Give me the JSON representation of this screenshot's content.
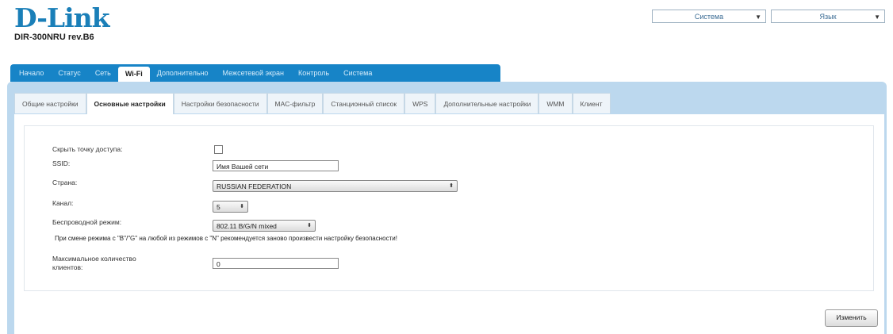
{
  "brand": {
    "logo": "D-Link",
    "model": "DIR-300NRU rev.B6",
    "color": "#1a7fb8"
  },
  "top_selects": [
    {
      "value": "Система"
    },
    {
      "value": "Язык"
    }
  ],
  "main_tabs": [
    {
      "label": "Начало",
      "active": false
    },
    {
      "label": "Статус",
      "active": false
    },
    {
      "label": "Сеть",
      "active": false
    },
    {
      "label": "Wi-Fi",
      "active": true
    },
    {
      "label": "Дополнительно",
      "active": false
    },
    {
      "label": "Межсетевой экран",
      "active": false
    },
    {
      "label": "Контроль",
      "active": false
    },
    {
      "label": "Система",
      "active": false
    }
  ],
  "sub_tabs": [
    {
      "label": "Общие настройки",
      "active": false
    },
    {
      "label": "Основные настройки",
      "active": true
    },
    {
      "label": "Настройки безопасности",
      "active": false
    },
    {
      "label": "MAC-фильтр",
      "active": false
    },
    {
      "label": "Станционный список",
      "active": false
    },
    {
      "label": "WPS",
      "active": false
    },
    {
      "label": "Дополнительные настройки",
      "active": false
    },
    {
      "label": "WMM",
      "active": false
    },
    {
      "label": "Клиент",
      "active": false
    }
  ],
  "form": {
    "hide_ap_label": "Скрыть точку доступа:",
    "hide_ap_checked": false,
    "ssid_label": "SSID:",
    "ssid_value": "Имя Вашей сети",
    "country_label": "Страна:",
    "country_value": "RUSSIAN FEDERATION",
    "channel_label": "Канал:",
    "channel_value": "5",
    "mode_label": "Беспроводной режим:",
    "mode_value": "802.11 B/G/N mixed",
    "mode_note": "При смене режима с \"B\"/\"G\" на любой из режимов с \"N\" рекомендуется заново произвести настройку безопасности!",
    "max_clients_label_line1": "Максимальное количество",
    "max_clients_label_line2": "клиентов:",
    "max_clients_value": "0"
  },
  "apply_button": "Изменить",
  "colors": {
    "tab_bar": "#1784c7",
    "panel_bg": "#bcd8ee"
  }
}
